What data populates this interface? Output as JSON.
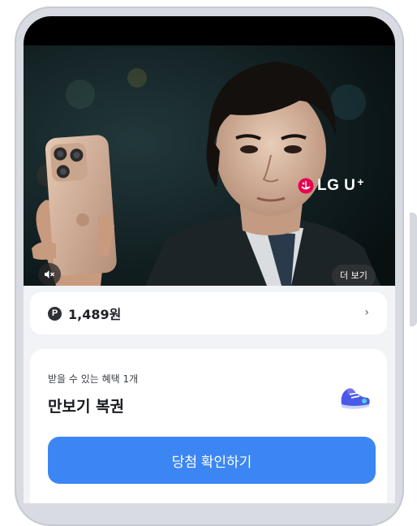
{
  "hero": {
    "brand_text": "LG U",
    "brand_plus": "+",
    "mute_icon": "mute-icon",
    "more_label": "더 보기"
  },
  "points": {
    "badge": "P",
    "value": "1,489원",
    "chevron": "›"
  },
  "benefit": {
    "subtitle": "받을 수 있는 혜택 1개",
    "title": "만보기 복권",
    "icon": "sneaker-icon",
    "cta_label": "당첨 확인하기"
  },
  "colors": {
    "accent": "#3c86f3",
    "brand": "#e6004e",
    "background": "#f2f3f6"
  }
}
